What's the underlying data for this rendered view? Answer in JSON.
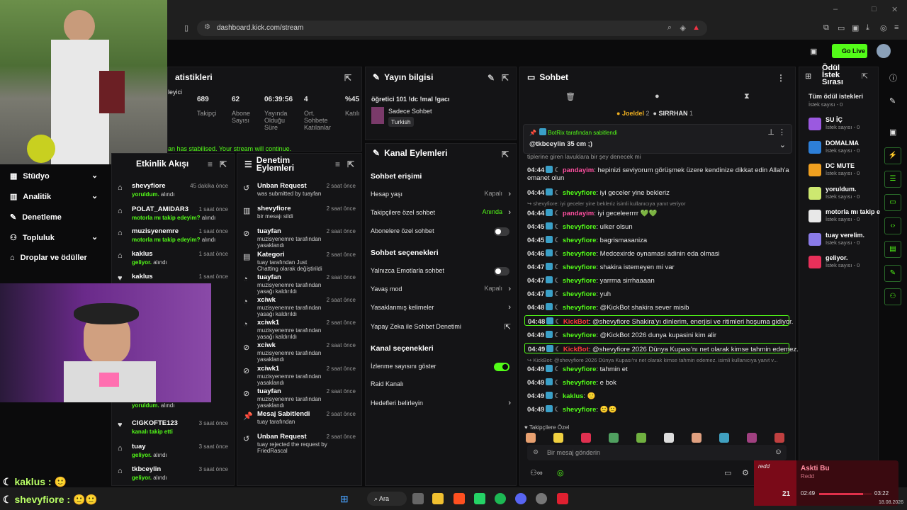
{
  "browser": {
    "url": "dashboard.kick.com/stream",
    "go_live": "Go Live"
  },
  "sidebar": {
    "items": [
      {
        "label": "Stüdyo"
      },
      {
        "label": "Analitik"
      },
      {
        "label": "Denetleme"
      },
      {
        "label": "Topluluk"
      },
      {
        "label": "Droplar ve ödüller"
      }
    ]
  },
  "stats": {
    "title": "atistikleri",
    "labels": [
      "leyici",
      "Takipçi",
      "Abone Sayısı",
      "Yayında Olduğu Süre",
      "Ort. Sohbete Katılanlar",
      "Katılı"
    ],
    "values": [
      "689",
      "62",
      "06:39:56",
      "4",
      "%45"
    ],
    "banner": "an has stabilised. Your stream will continue."
  },
  "stream_info": {
    "title": "Yayın bilgisi",
    "stream_title": "öğretici 101 !dc !mal !gacı",
    "category": "Sadece Sohbet",
    "tag": "Turkish"
  },
  "channel_actions": {
    "title": "Kanal Eylemleri",
    "chat_access": "Sohbet erişimi",
    "account_age": "Hesap yaşı",
    "account_age_val": "Kapalı",
    "follower_chat": "Takipçilere özel sohbet",
    "follower_chat_val": "Anında",
    "sub_chat": "Abonelere özel sohbet",
    "chat_options": "Sohbet seçenekleri",
    "emote_only": "Yalnızca Emotlarla sohbet",
    "slow_mode": "Yavaş mod",
    "slow_mode_val": "Kapalı",
    "banned_words": "Yasaklanmış kelimeler",
    "ai_mod": "Yapay Zeka ile Sohbet Denetimi",
    "channel_options": "Kanal seçenekleri",
    "show_viewers": "İzlenme sayısını göster",
    "raid": "Raid Kanalı",
    "goals": "Hedefleri belirleyin"
  },
  "activity": {
    "title": "Etkinlik Akışı",
    "items": [
      {
        "name": "shevyfiore",
        "sub": "yoruldum.",
        "suffix": " alındı",
        "time": "45 dakika önce"
      },
      {
        "name": "POLAT_AMIDAR3",
        "sub": "motorla mı takip edeyim?",
        "suffix": " alındı",
        "time": "1 saat önce"
      },
      {
        "name": "muzisyenemre",
        "sub": "motorla mı takip edeyim?",
        "suffix": " alındı",
        "time": "1 saat önce"
      },
      {
        "name": "kaklus",
        "sub": "geliyor.",
        "suffix": " alındı",
        "time": "1 saat önce"
      },
      {
        "name": "kaklus",
        "sub": "",
        "suffix": "",
        "time": "1 saat önce"
      },
      {
        "name": "CIGKOFTE123",
        "sub": "kanalı takip etti",
        "suffix": "",
        "time": "3 saat önce"
      },
      {
        "name": "tuay",
        "sub": "geliyor.",
        "suffix": " alındı",
        "time": "3 saat önce"
      },
      {
        "name": "tkbceylin",
        "sub": "geliyor.",
        "suffix": " alındı",
        "time": "3 saat önce"
      }
    ],
    "partial": "yoruldum."
  },
  "mod_actions": {
    "title": "Denetim Eylemleri",
    "items": [
      {
        "name": "Unban Request",
        "sub": "was submitted by tuayfan",
        "time": "2 saat önce"
      },
      {
        "name": "shevyfiore",
        "sub": "bir mesajı sildi",
        "time": "2 saat önce"
      },
      {
        "name": "tuayfan",
        "sub": "muzisyenemre tarafından yasaklandı",
        "time": "2 saat önce"
      },
      {
        "name": "Kategori",
        "sub": "tuay tarafından Just Chatting olarak değiştirildi",
        "time": "2 saat önce"
      },
      {
        "name": "tuayfan",
        "sub": "muzisyenemre tarafından yasağı kaldırıldı",
        "time": "2 saat önce"
      },
      {
        "name": "xciwk",
        "sub": "muzisyenemre tarafından yasağı kaldırıldı",
        "time": "2 saat önce"
      },
      {
        "name": "xciwk1",
        "sub": "muzisyenemre tarafından yasağı kaldırıldı",
        "time": "2 saat önce"
      },
      {
        "name": "xciwk",
        "sub": "muzisyenemre tarafından yasaklandı",
        "time": "2 saat önce"
      },
      {
        "name": "xciwk1",
        "sub": "muzisyenemre tarafından yasaklandı",
        "time": "2 saat önce"
      },
      {
        "name": "tuayfan",
        "sub": "muzisyenemre tarafından yasaklandı",
        "time": "2 saat önce"
      },
      {
        "name": "Mesaj Sabitlendi",
        "sub": "tuay tarafından",
        "time": "2 saat önce"
      },
      {
        "name": "Unban Request",
        "sub": "tuay rejected the request by FriedRascal",
        "time": "2 saat önce"
      }
    ]
  },
  "chat": {
    "title": "Sohbet",
    "top_users": [
      {
        "name": "Joeldel",
        "n": "2"
      },
      {
        "name": "SIRRHAN",
        "n": "1"
      }
    ],
    "pinned_by": "BotRix tarafından sabitlendi",
    "pinned_msg": "@tkbceylin 35 cm ;)",
    "pinned_under": "tiplerine giren lavuklara bir şey denecek mi",
    "lines": [
      {
        "time": "04:44",
        "user": "pandayim",
        "msg": "hepinizi seviyorum görüşmek üzere kendinize dikkat edin Allah'a",
        "pink": true
      },
      {
        "time": "",
        "user": "",
        "msg": "emanet olun"
      },
      {
        "time": "04:44",
        "user": "shevyfiore",
        "msg": "iyi geceler yine bekleriz"
      },
      {
        "time": "",
        "user": "",
        "msg": "↪ shevyfiore: iyi geceler yine bekleriz isimli kullanıcıya yanıt veriyor",
        "reply": true
      },
      {
        "time": "04:44",
        "user": "pandayim",
        "msg": "iyi geceleerrrr 💚💚",
        "pink": true
      },
      {
        "time": "04:45",
        "user": "shevyfiore",
        "msg": "ulker olsun"
      },
      {
        "time": "04:45",
        "user": "shevyfiore",
        "msg": "bagrismasaniza"
      },
      {
        "time": "04:46",
        "user": "shevyfiore",
        "msg": "Medcexirde oynamasi adinin eda olmasi"
      },
      {
        "time": "04:47",
        "user": "shevyfiore",
        "msg": "shakira istemeyen mi var"
      },
      {
        "time": "04:47",
        "user": "shevyfiore",
        "msg": "yarrma sirrhaaaan"
      },
      {
        "time": "04:47",
        "user": "shevyfiore",
        "msg": "yuh"
      },
      {
        "time": "04:48",
        "user": "shevyfiore",
        "msg": "@KickBot shakira sever misib"
      },
      {
        "time": "04:48",
        "user": "KickBot",
        "msg": "@shevyfiore Shakira'yı dinlerim, enerjisi ve ritimleri hoşuma gidiyor.",
        "bot": true
      },
      {
        "time": "04:49",
        "user": "shevyfiore",
        "msg": "@KickBot 2026 dunya kupasini kim alir"
      },
      {
        "time": "04:49",
        "user": "KickBot",
        "msg": "@shevyfiore 2026 Dünya Kupası'nı net olarak kimse tahmin edemez.",
        "bot": true
      },
      {
        "time": "",
        "user": "",
        "msg": "↪ KickBot: @shevyfiore 2026 Dünya Kupası'nı net olarak kimse tahmin edemez. isimli kullanıcıya yanıt v...",
        "reply": true
      },
      {
        "time": "04:49",
        "user": "shevyfiore",
        "msg": "tahmin et"
      },
      {
        "time": "04:49",
        "user": "shevyfiore",
        "msg": "e bok"
      },
      {
        "time": "04:49",
        "user": "kaklus",
        "msg": "🙂"
      },
      {
        "time": "04:49",
        "user": "shevyfiore",
        "msg": "🙂🙂"
      }
    ],
    "emote_label": "Takipçilere Özel",
    "input_placeholder": "Bir mesaj gönderin"
  },
  "rewards": {
    "title": "Ödül İstek Sırası",
    "all": "Tüm ödül istekleri",
    "count_label": "İstek sayısı - 0",
    "items": [
      {
        "name": "SU İÇ",
        "color": "#9b59e0"
      },
      {
        "name": "DOMALMA",
        "color": "#2d7fd8"
      },
      {
        "name": "DC MUTE",
        "color": "#f0a020"
      },
      {
        "name": "yoruldum.",
        "color": "#cde870"
      },
      {
        "name": "motorla mı takip e",
        "color": "#e8e8e8"
      },
      {
        "name": "tuay verelim.",
        "color": "#8a7be8"
      },
      {
        "name": "geliyor.",
        "color": "#e8305a"
      }
    ]
  },
  "overlay": {
    "line1_user": "kaklus",
    "line2_user": "shevyfiore",
    "line2_emotes": "🙂🙂"
  },
  "music": {
    "title": "Askti Bu",
    "artist": "Redd",
    "elapsed": "02:49",
    "total": "03:22",
    "thumb": "redd",
    "count": "21"
  },
  "taskbar": {
    "search": "Ara",
    "date": "18.08.2026"
  }
}
